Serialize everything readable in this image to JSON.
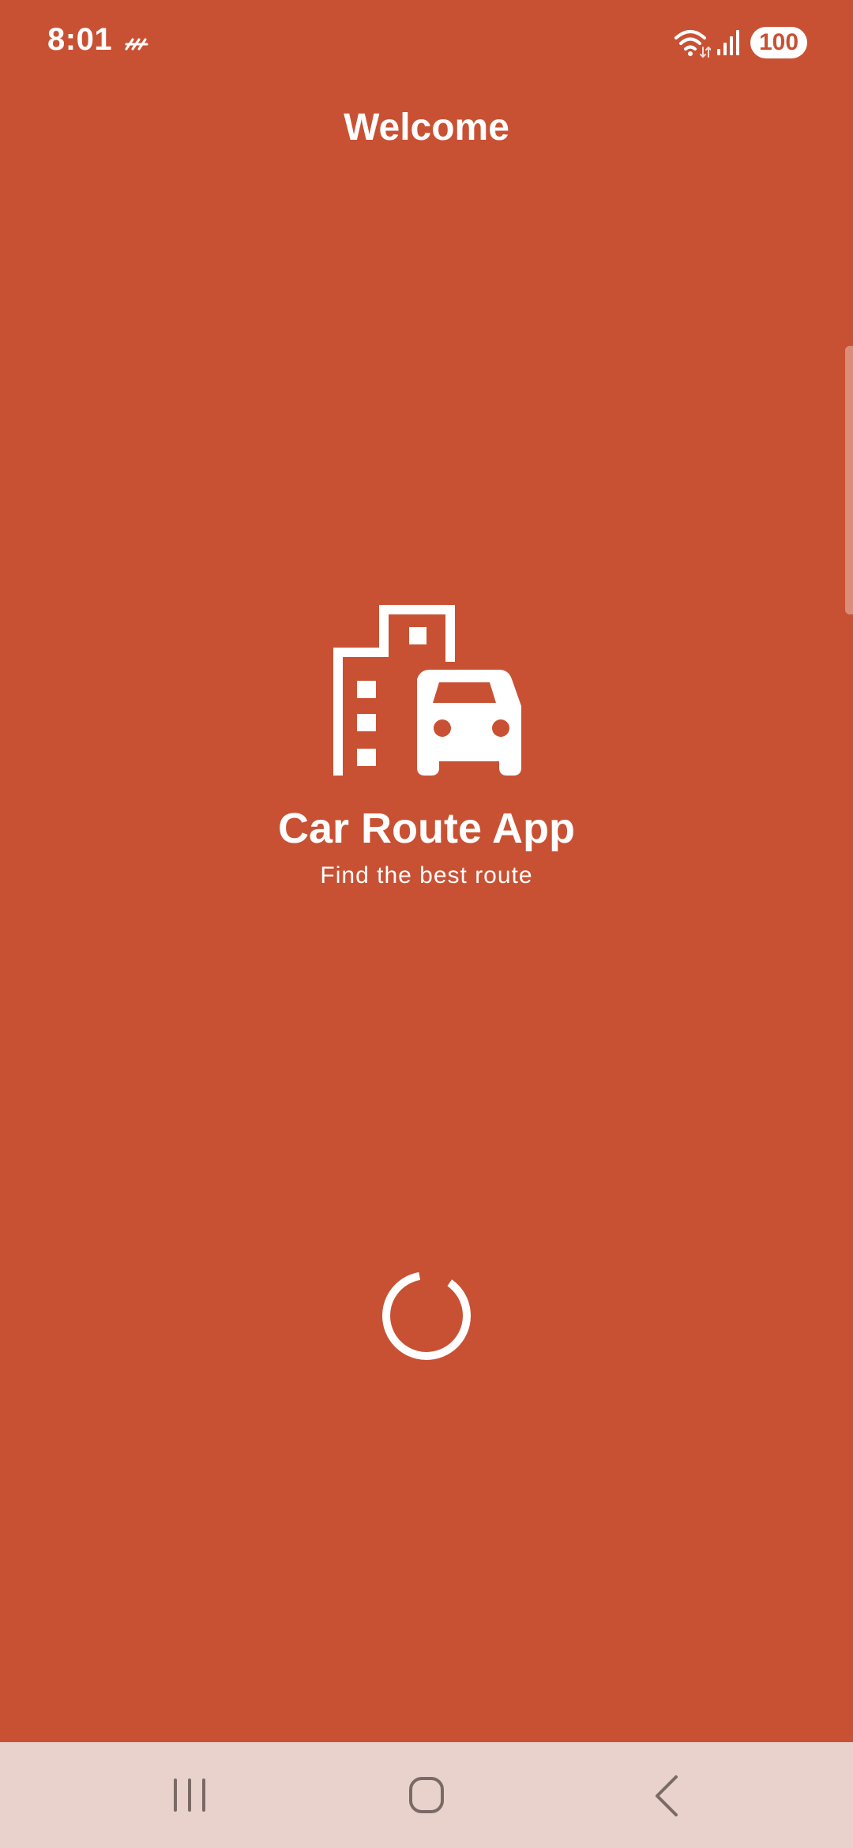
{
  "status_bar": {
    "time": "8:01",
    "battery": "100",
    "icons": [
      "data-saver-icon",
      "wifi-icon",
      "signal-icon",
      "battery-icon"
    ]
  },
  "header": {
    "title": "Welcome"
  },
  "splash": {
    "logo_icon": "city-car-icon",
    "app_name": "Car Route App",
    "tagline": "Find the best route",
    "loading_indicator": "spinner"
  },
  "nav_bar": {
    "buttons": [
      "recents-button",
      "home-button",
      "back-button"
    ]
  },
  "colors": {
    "background": "#c95133",
    "foreground": "#ffffff",
    "nav_bar": "#ead2cc",
    "nav_icon": "#7a6a66"
  }
}
